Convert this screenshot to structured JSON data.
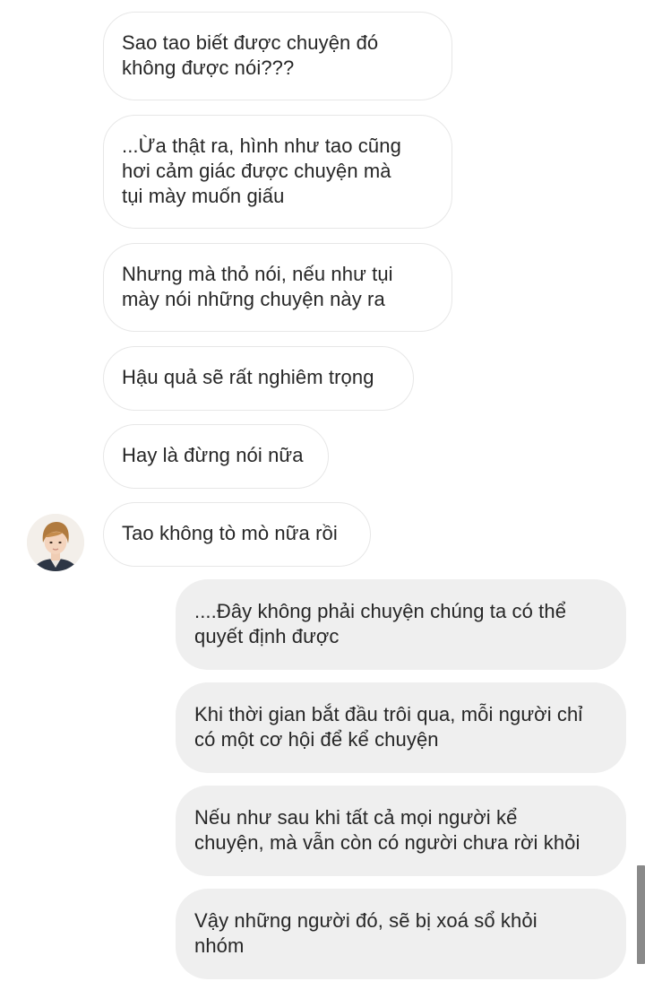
{
  "messages": {
    "incoming": [
      {
        "text": "Sao tao biết được chuyện đó\nkhông được nói???"
      },
      {
        "text": "...Ừa thật ra, hình như tao cũng\nhơi cảm giác được chuyện mà\ntụi mày muốn giấu"
      },
      {
        "text": "Nhưng mà thỏ nói, nếu như tụi\nmày nói những chuyện này ra"
      },
      {
        "text": "Hậu quả sẽ rất nghiêm trọng"
      },
      {
        "text": "Hay là đừng nói nữa"
      },
      {
        "text": "Tao không tò mò nữa rồi"
      }
    ],
    "outgoing": [
      {
        "text": "....Đây không phải chuyện chúng ta có thể\nquyết định được"
      },
      {
        "text": "Khi thời gian bắt đầu trôi qua, mỗi người chỉ\ncó một cơ hội để kể chuyện"
      },
      {
        "text": "Nếu như sau khi tất cả mọi người kể\nchuyện, mà vẫn còn có người chưa rời khỏi"
      },
      {
        "text": "Vậy những người đó, sẽ bị xoá sổ khỏi\nnhóm"
      }
    ]
  },
  "colors": {
    "incoming_bg": "#ffffff",
    "incoming_border": "#e7e7e7",
    "outgoing_bg": "#efefef",
    "text": "#262626"
  }
}
